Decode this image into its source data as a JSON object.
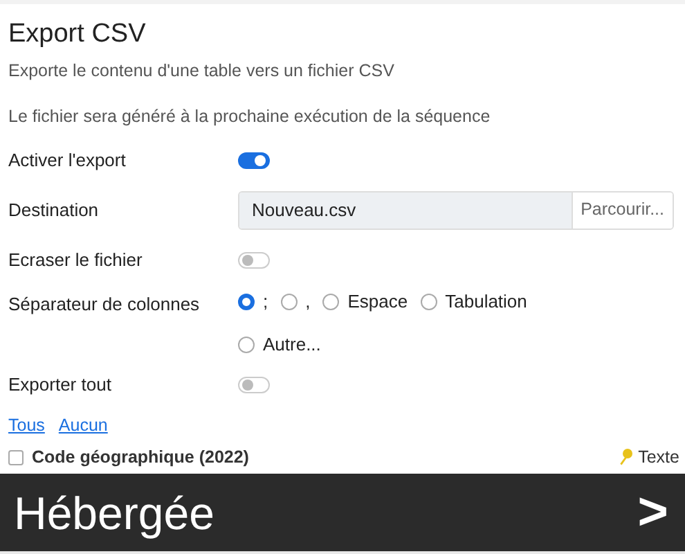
{
  "title": "Export CSV",
  "description": "Exporte le contenu d'une table vers un fichier CSV",
  "note": "Le fichier sera généré à la prochaine exécution de la séquence",
  "fields": [
    {
      "kind": "toggle",
      "label": "Activer l'export",
      "on": true
    },
    {
      "kind": "file",
      "label": "Destination",
      "value": "Nouveau.csv",
      "button": "Parcourir..."
    },
    {
      "kind": "toggle",
      "label": "Ecraser le fichier",
      "on": false
    },
    {
      "kind": "radio",
      "label": "Séparateur de colonnes",
      "options": [
        {
          "label": ";",
          "selected": true
        },
        {
          "label": ",",
          "selected": false
        },
        {
          "label": "Espace",
          "selected": false
        },
        {
          "label": "Tabulation",
          "selected": false
        },
        {
          "label": "Autre...",
          "selected": false
        }
      ]
    },
    {
      "kind": "toggle",
      "label": "Exporter tout",
      "on": false
    }
  ],
  "links": [
    "Tous",
    "Aucun"
  ],
  "columns": [
    {
      "name": "Code géographique (2022)",
      "checked": false,
      "type": "Texte"
    }
  ],
  "banner": {
    "title": "Hébergée",
    "arrow": ">"
  }
}
